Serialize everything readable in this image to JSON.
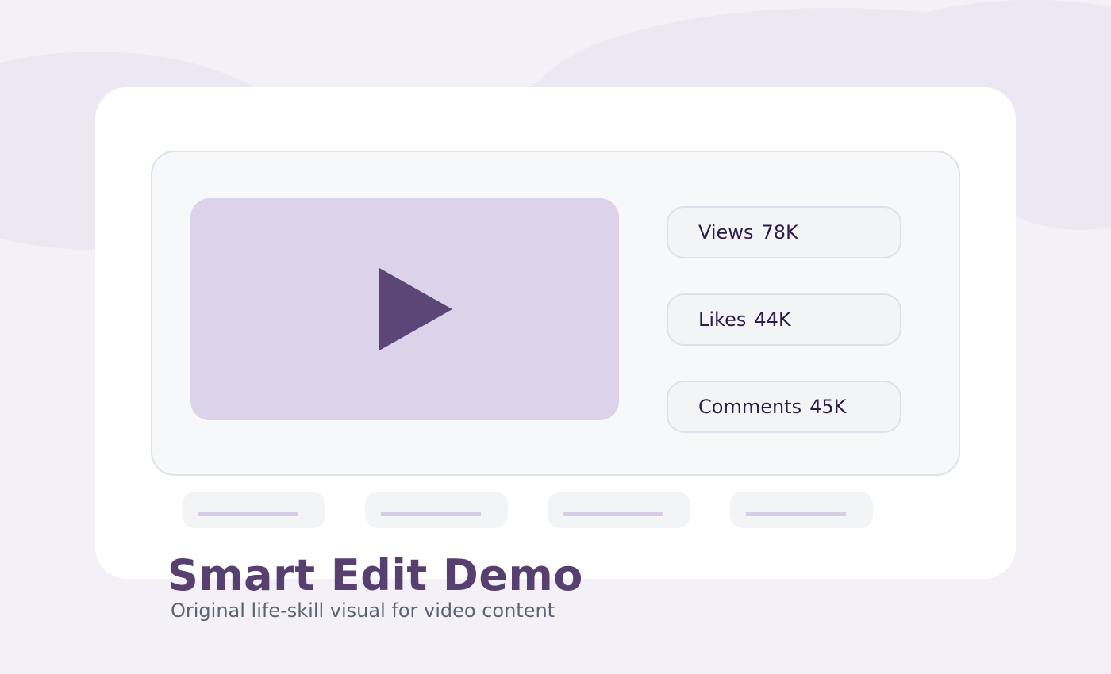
{
  "colors": {
    "background": "#f3f0f7",
    "accent": "#5b4677",
    "video_bg": "#dcd3ea",
    "title": "#57406f"
  },
  "player": {
    "icon": "play-icon"
  },
  "stats": [
    {
      "label": "Views",
      "value": "78K"
    },
    {
      "label": "Likes",
      "value": "44K"
    },
    {
      "label": "Comments",
      "value": "45K"
    }
  ],
  "heading": {
    "title": "Smart Edit Demo",
    "subtitle": "Original life-skill visual for video content"
  }
}
